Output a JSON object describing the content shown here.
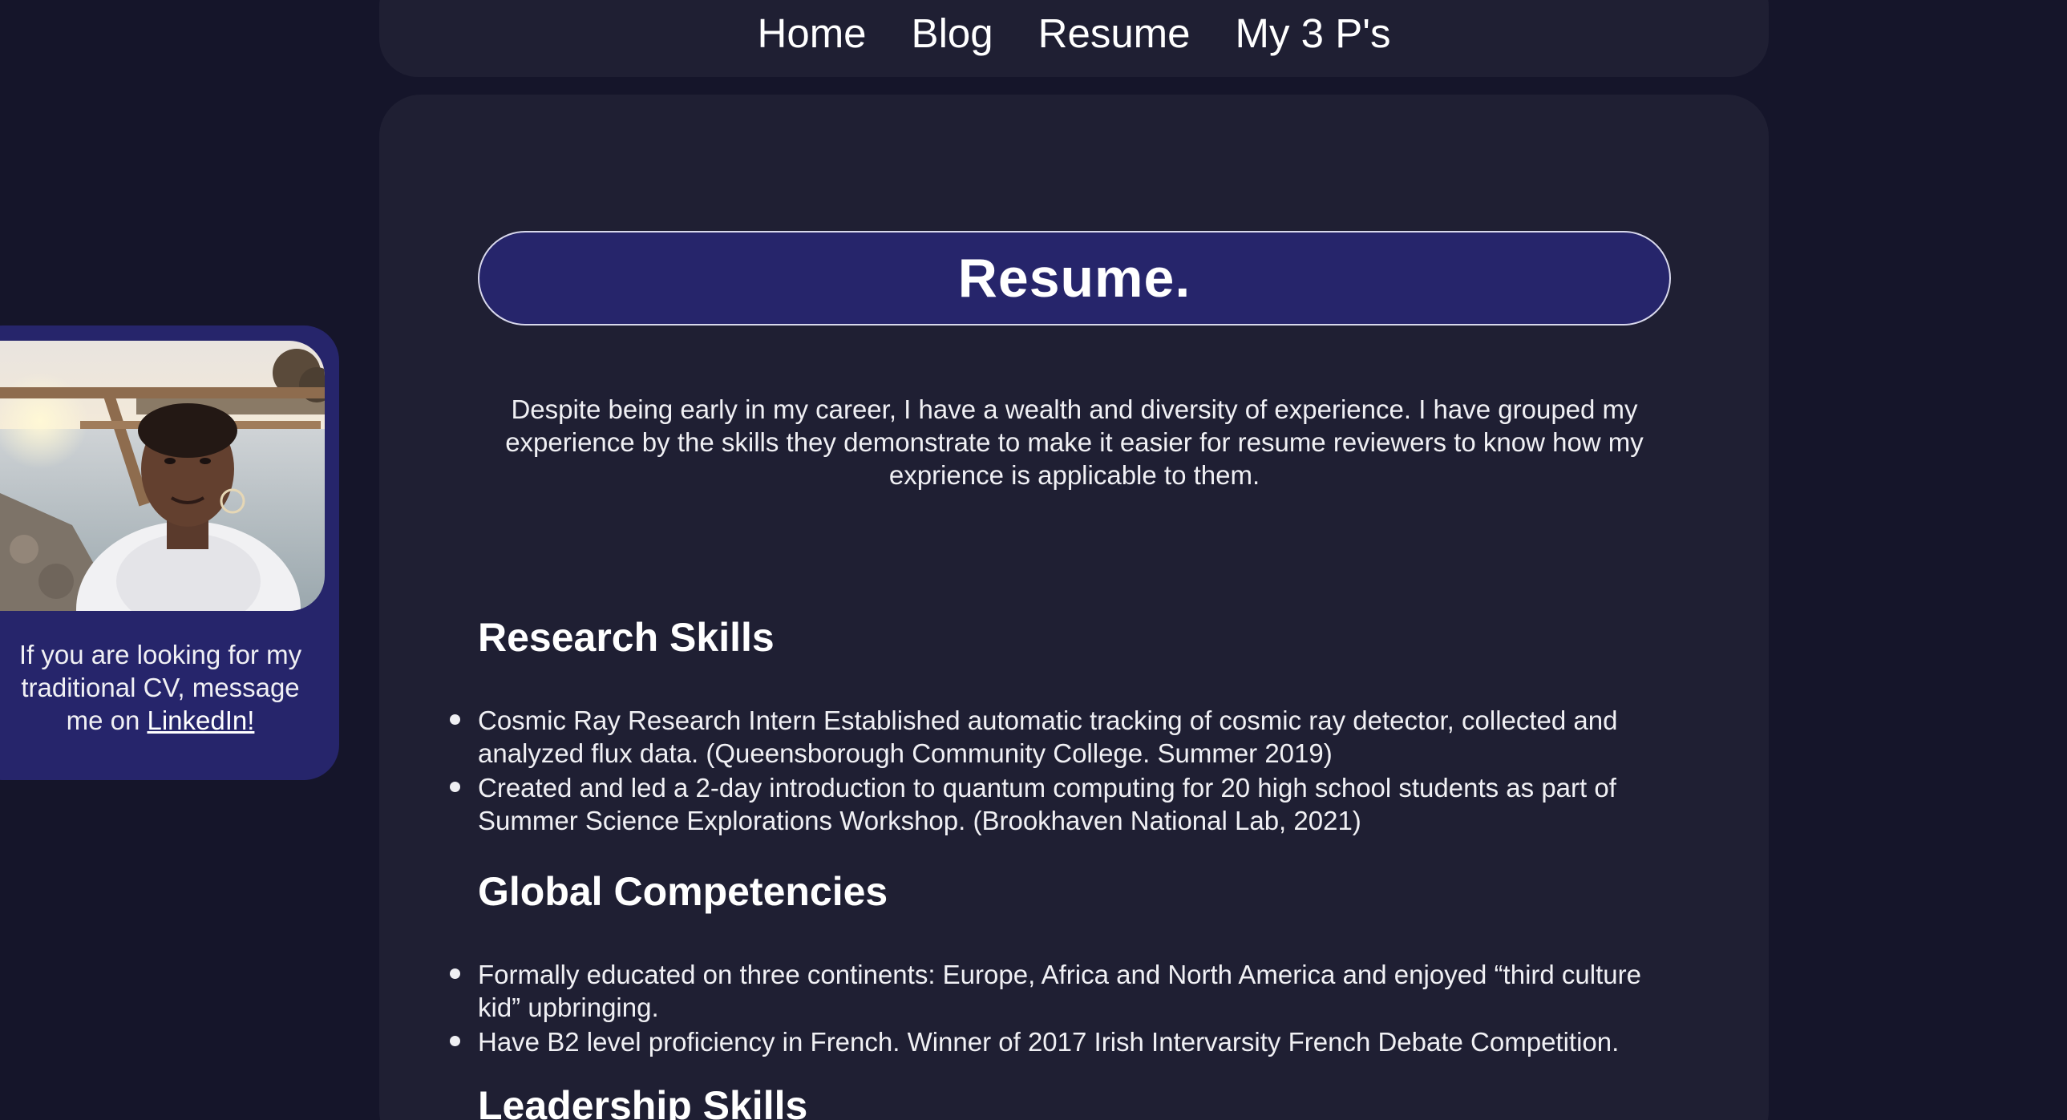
{
  "nav": {
    "items": [
      {
        "label": "Home"
      },
      {
        "label": "Blog"
      },
      {
        "label": "Resume"
      },
      {
        "label": "My 3 P's"
      }
    ]
  },
  "main": {
    "title": "Resume.",
    "intro": "Despite being early in my career, I have a wealth and diversity of experience. I have grouped my experience by the skills they demonstrate to make it easier for resume reviewers to know how my exprience is applicable to them.",
    "sections": [
      {
        "heading": "Research Skills",
        "items": [
          "Cosmic Ray Research Intern Established automatic tracking of cosmic ray detector, collected and analyzed flux data. (Queensborough Community College. Summer 2019)",
          "Created and led a 2-day introduction to quantum computing for 20 high school students as part of Summer Science Explorations Workshop. (Brookhaven National Lab, 2021)"
        ]
      },
      {
        "heading": "Global Competencies",
        "items": [
          "Formally educated on three continents: Europe, Africa and North America and enjoyed “third culture kid” upbringing.",
          "Have B2 level proficiency in French. Winner of 2017 Irish Intervarsity French Debate Competition."
        ]
      },
      {
        "heading": "Leadership Skills",
        "items": []
      }
    ]
  },
  "sidebar": {
    "text_before": "If you are looking for my traditional CV, message me on ",
    "link_label": "LinkedIn!"
  }
}
